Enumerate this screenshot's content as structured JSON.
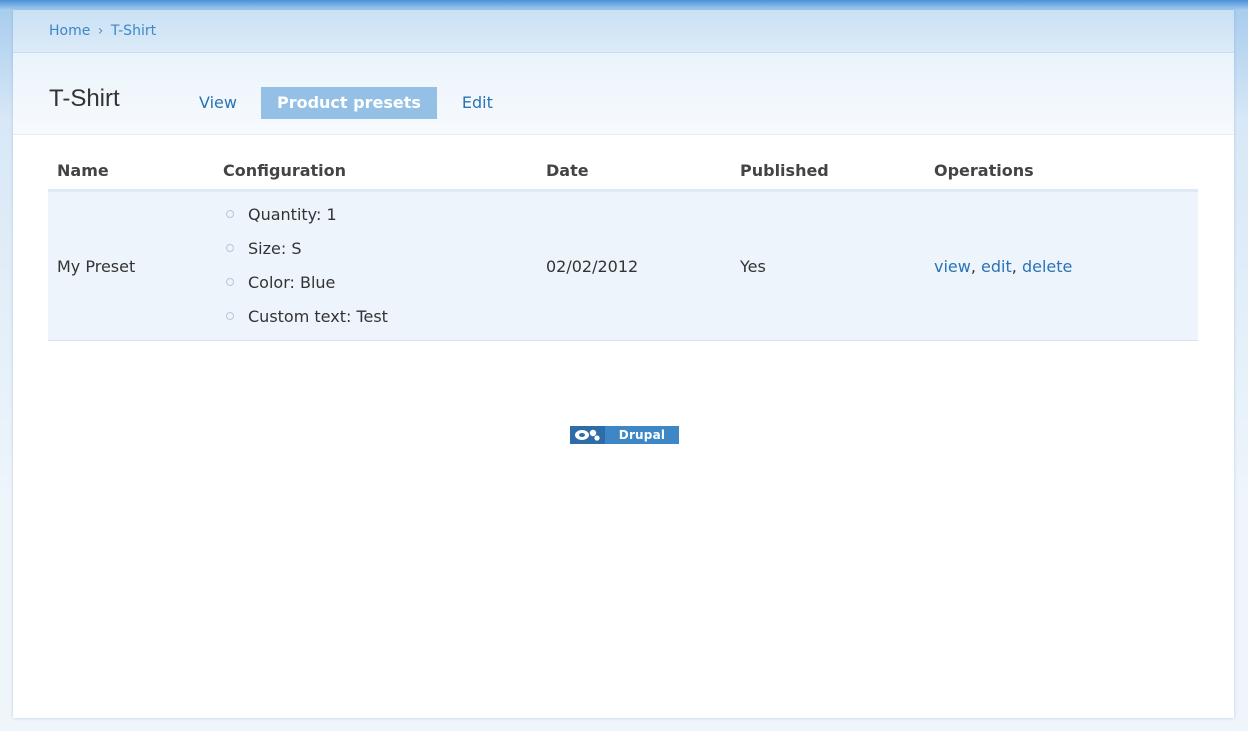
{
  "breadcrumb": {
    "home": "Home",
    "separator": "›",
    "current": "T-Shirt"
  },
  "page_title": "T-Shirt",
  "tabs": [
    {
      "label": "View",
      "active": false
    },
    {
      "label": "Product presets",
      "active": true
    },
    {
      "label": "Edit",
      "active": false
    }
  ],
  "table": {
    "headers": [
      "Name",
      "Configuration",
      "Date",
      "Published",
      "Operations"
    ],
    "rows": [
      {
        "name": "My Preset",
        "configuration": [
          "Quantity: 1",
          "Size: S",
          "Color: Blue",
          "Custom text: Test"
        ],
        "date": "02/02/2012",
        "published": "Yes",
        "operations": {
          "view": "view",
          "edit": "edit",
          "delete": "delete",
          "sep": ","
        }
      }
    ]
  },
  "footer": {
    "powered_by": "Drupal"
  },
  "colors": {
    "link": "#2a73b8",
    "active_tab_bg": "#93c0e4",
    "row_bg": "#edf4fb"
  }
}
